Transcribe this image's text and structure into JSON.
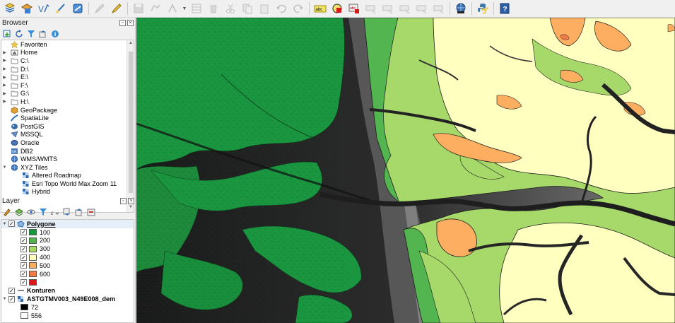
{
  "browser": {
    "title": "Browser",
    "items": [
      {
        "label": "Favoriten",
        "icon": "star-icon",
        "expand": ""
      },
      {
        "label": "Home",
        "icon": "home-folder-icon",
        "expand": "▶"
      },
      {
        "label": "C:\\",
        "icon": "folder-icon",
        "expand": "▶"
      },
      {
        "label": "D:\\",
        "icon": "folder-icon",
        "expand": "▶"
      },
      {
        "label": "E:\\",
        "icon": "folder-icon",
        "expand": "▶"
      },
      {
        "label": "F:\\",
        "icon": "folder-icon",
        "expand": "▶"
      },
      {
        "label": "G:\\",
        "icon": "folder-icon",
        "expand": "▶"
      },
      {
        "label": "H:\\",
        "icon": "folder-icon",
        "expand": "▶"
      },
      {
        "label": "GeoPackage",
        "icon": "geopackage-icon",
        "expand": ""
      },
      {
        "label": "SpatiaLite",
        "icon": "spatialite-icon",
        "expand": ""
      },
      {
        "label": "PostGIS",
        "icon": "postgis-icon",
        "expand": ""
      },
      {
        "label": "MSSQL",
        "icon": "mssql-icon",
        "expand": ""
      },
      {
        "label": "Oracle",
        "icon": "oracle-icon",
        "expand": ""
      },
      {
        "label": "DB2",
        "icon": "db2-icon",
        "expand": ""
      },
      {
        "label": "WMS/WMTS",
        "icon": "wms-icon",
        "expand": ""
      },
      {
        "label": "XYZ Tiles",
        "icon": "xyz-tiles-icon",
        "expand": "▼"
      },
      {
        "label": "Altered Roadmap",
        "icon": "tile-icon",
        "expand": "",
        "indent": true
      },
      {
        "label": "Esri Topo World Max Zoom 11",
        "icon": "tile-icon",
        "expand": "",
        "indent": true
      },
      {
        "label": "Hybrid",
        "icon": "tile-icon",
        "expand": "",
        "indent": true
      }
    ]
  },
  "layers": {
    "title": "Layer",
    "polygon_layer": {
      "name": "Polygone"
    },
    "classes": [
      {
        "label": "100",
        "color": "#1a9641"
      },
      {
        "label": "200",
        "color": "#52b550"
      },
      {
        "label": "300",
        "color": "#a6d96a"
      },
      {
        "label": "400",
        "color": "#ffffbf"
      },
      {
        "label": "500",
        "color": "#fdae61"
      },
      {
        "label": "600",
        "color": "#f07c4a"
      },
      {
        "label": "",
        "color": "#d7191c"
      }
    ],
    "contour_layer": {
      "name": "Konturen"
    },
    "dem_layer": {
      "name": "ASTGTMV003_N49E008_dem",
      "min": "72",
      "max": "556"
    }
  }
}
